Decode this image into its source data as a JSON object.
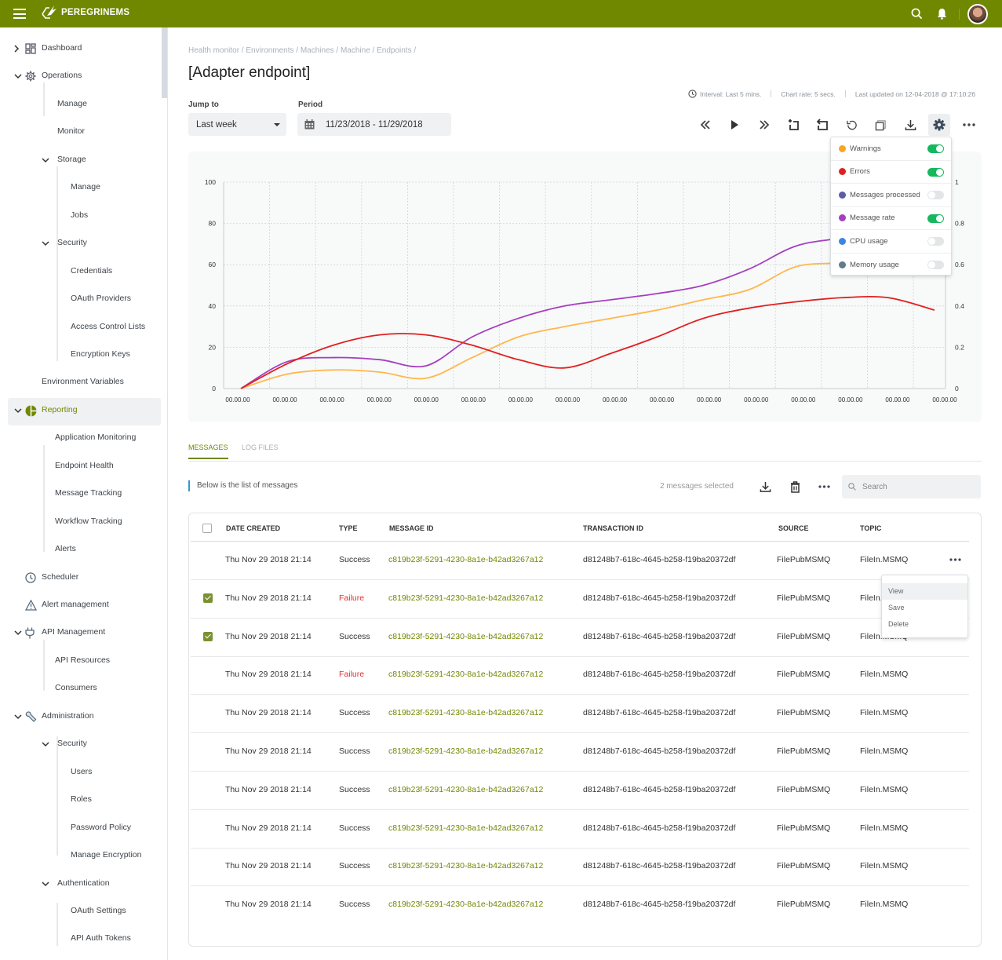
{
  "app": {
    "brand": "PEREGRINEMS",
    "brand_color": "#6f8800"
  },
  "topbar": {
    "icons": [
      "menu-icon",
      "search-icon",
      "bell-icon",
      "avatar"
    ]
  },
  "sidebar": {
    "items": [
      {
        "label": "Dashboard",
        "icon": "dashboard-icon",
        "level": 0,
        "expander": "chevron-right"
      },
      {
        "label": "Operations",
        "icon": "gear-icon",
        "level": 0,
        "expander": "chevron-down"
      },
      {
        "label": "Manage",
        "level": 1
      },
      {
        "label": "Monitor",
        "level": 1
      },
      {
        "label": "Storage",
        "level": 1,
        "expander": "chevron-down"
      },
      {
        "label": "Manage",
        "level": 2
      },
      {
        "label": "Jobs",
        "level": 2
      },
      {
        "label": "Security",
        "level": 1,
        "expander": "chevron-down"
      },
      {
        "label": "Credentials",
        "level": 2
      },
      {
        "label": "OAuth Providers",
        "level": 2
      },
      {
        "label": "Access Control Lists",
        "level": 2
      },
      {
        "label": "Encryption Keys",
        "level": 2
      },
      {
        "label": "Environment Variables",
        "level": 0
      },
      {
        "label": "Reporting",
        "icon": "pie-chart-icon",
        "level": 0,
        "expander": "chevron-down",
        "active": true
      },
      {
        "label": "Application Monitoring",
        "level": 1,
        "selected": true
      },
      {
        "label": "Endpoint Health",
        "level": 1
      },
      {
        "label": "Message Tracking",
        "level": 1
      },
      {
        "label": "Workflow Tracking",
        "level": 1
      },
      {
        "label": "Alerts",
        "level": 1
      },
      {
        "label": "Scheduler",
        "icon": "clock-icon",
        "level": 0
      },
      {
        "label": "Alert management",
        "icon": "warning-icon",
        "level": 0
      },
      {
        "label": "API Management",
        "icon": "plug-icon",
        "level": 0,
        "expander": "chevron-down"
      },
      {
        "label": "API Resources",
        "level": 1
      },
      {
        "label": "Consumers",
        "level": 1
      },
      {
        "label": "Administration",
        "icon": "wrench-icon",
        "level": 0,
        "expander": "chevron-down"
      },
      {
        "label": "Security",
        "level": 1,
        "expander": "chevron-down"
      },
      {
        "label": "Users",
        "level": 2
      },
      {
        "label": "Roles",
        "level": 2
      },
      {
        "label": "Password Policy",
        "level": 2
      },
      {
        "label": "Manage Encryption",
        "level": 2
      },
      {
        "label": "Authentication",
        "level": 1,
        "expander": "chevron-down"
      },
      {
        "label": "OAuth Settings",
        "level": 2
      },
      {
        "label": "API Auth Tokens",
        "level": 2
      }
    ]
  },
  "page": {
    "breadcrumb": "Health monitor / Environments / Machines / Machine / Endpoints /",
    "title": "[Adapter endpoint]",
    "jump_to_label": "Jump to",
    "jump_to_value": "Last week",
    "period_label": "Period",
    "period_value": "11/23/2018 -  11/29/2018",
    "interval": "Interval: Last 5 mins.",
    "chart_rate": "Chart rate: 5 secs.",
    "last_updated": "Last updated on 12-04-2018 @ 17:10:26",
    "toolbar": [
      "rewind-icon",
      "play-icon",
      "fast-forward-icon",
      "crop-icon",
      "undo-crop-icon",
      "refresh-icon",
      "copy-icon",
      "download-icon",
      "settings-icon",
      "more-icon"
    ]
  },
  "legend": [
    {
      "label": "Warnings",
      "color": "#f5a623",
      "on": true
    },
    {
      "label": "Errors",
      "color": "#e02020",
      "on": true
    },
    {
      "label": "Messages processed",
      "color": "#5b5ea6",
      "on": false
    },
    {
      "label": "Message rate",
      "color": "#a43fbf",
      "on": true
    },
    {
      "label": "CPU usage",
      "color": "#3b86e0",
      "on": false
    },
    {
      "label": "Memory usage",
      "color": "#607d8b",
      "on": false
    }
  ],
  "chart_data": {
    "type": "line",
    "title": "",
    "xlabel": "",
    "ylabel": "",
    "x": [
      "00.00.00",
      "00.00.00",
      "00.00.00",
      "00.00.00",
      "00.00.00",
      "00.00.00",
      "00.00.00",
      "00.00.00",
      "00.00.00",
      "00.00.00",
      "00.00.00",
      "00.00.00",
      "00.00.00",
      "00.00.00",
      "00.00.00",
      "00.00.00"
    ],
    "ylim": [
      0,
      100
    ],
    "yticks": [
      0,
      20,
      40,
      60,
      80,
      100
    ],
    "y2lim": [
      0,
      1
    ],
    "y2ticks": [
      "0",
      "0.2",
      "0.4",
      "0.6",
      "0.8",
      "1"
    ],
    "grid": true,
    "legend_position": "top-right",
    "series": [
      {
        "name": "Message rate",
        "color": "#a43fbf",
        "values": [
          0,
          13,
          15,
          14,
          11,
          25,
          34,
          40,
          43,
          46,
          50,
          58,
          69,
          73,
          77,
          80
        ]
      },
      {
        "name": "Warnings",
        "color": "#ffb74d",
        "values": [
          0,
          7,
          9,
          8,
          5,
          15,
          25,
          30,
          34,
          38,
          43,
          48,
          59,
          61,
          64,
          68
        ]
      },
      {
        "name": "Errors",
        "color": "#e02020",
        "values": [
          0,
          12,
          21,
          26,
          26,
          21,
          14,
          10,
          17,
          25,
          34,
          39,
          42,
          44,
          44,
          38
        ]
      }
    ]
  },
  "tabs": [
    {
      "label": "MESSAGES",
      "active": true
    },
    {
      "label": "LOG FILES",
      "active": false
    }
  ],
  "messages": {
    "description": "Below is the list of messages",
    "selected_count": "2 messages selected",
    "search_placeholder": "Search",
    "columns": [
      "DATE CREATED",
      "TYPE",
      "MESSAGE ID",
      "TRANSACTION ID",
      "SOURCE",
      "TOPIC"
    ],
    "rows": [
      {
        "checked": false,
        "date": "Thu Nov 29 2018 21:14",
        "type": "Success",
        "message_id": "c819b23f-5291-4230-8a1e-b42ad3267a12",
        "transaction_id": "d81248b7-618c-4645-b258-f19ba20372df",
        "source": "FilePubMSMQ",
        "topic": "FileIn.MSMQ"
      },
      {
        "checked": true,
        "date": "Thu Nov 29 2018 21:14",
        "type": "Failure",
        "message_id": "c819b23f-5291-4230-8a1e-b42ad3267a12",
        "transaction_id": "d81248b7-618c-4645-b258-f19ba20372df",
        "source": "FilePubMSMQ",
        "topic": "FileIn.MSMQ"
      },
      {
        "checked": true,
        "date": "Thu Nov 29 2018 21:14",
        "type": "Success",
        "message_id": "c819b23f-5291-4230-8a1e-b42ad3267a12",
        "transaction_id": "d81248b7-618c-4645-b258-f19ba20372df",
        "source": "FilePubMSMQ",
        "topic": "FileIn.MSMQ"
      },
      {
        "checked": false,
        "date": "Thu Nov 29 2018 21:14",
        "type": "Failure",
        "message_id": "c819b23f-5291-4230-8a1e-b42ad3267a12",
        "transaction_id": "d81248b7-618c-4645-b258-f19ba20372df",
        "source": "FilePubMSMQ",
        "topic": "FileIn.MSMQ"
      },
      {
        "checked": false,
        "date": "Thu Nov 29 2018 21:14",
        "type": "Success",
        "message_id": "c819b23f-5291-4230-8a1e-b42ad3267a12",
        "transaction_id": "d81248b7-618c-4645-b258-f19ba20372df",
        "source": "FilePubMSMQ",
        "topic": "FileIn.MSMQ"
      },
      {
        "checked": false,
        "date": "Thu Nov 29 2018 21:14",
        "type": "Success",
        "message_id": "c819b23f-5291-4230-8a1e-b42ad3267a12",
        "transaction_id": "d81248b7-618c-4645-b258-f19ba20372df",
        "source": "FilePubMSMQ",
        "topic": "FileIn.MSMQ"
      },
      {
        "checked": false,
        "date": "Thu Nov 29 2018 21:14",
        "type": "Success",
        "message_id": "c819b23f-5291-4230-8a1e-b42ad3267a12",
        "transaction_id": "d81248b7-618c-4645-b258-f19ba20372df",
        "source": "FilePubMSMQ",
        "topic": "FileIn.MSMQ"
      },
      {
        "checked": false,
        "date": "Thu Nov 29 2018 21:14",
        "type": "Success",
        "message_id": "c819b23f-5291-4230-8a1e-b42ad3267a12",
        "transaction_id": "d81248b7-618c-4645-b258-f19ba20372df",
        "source": "FilePubMSMQ",
        "topic": "FileIn.MSMQ"
      },
      {
        "checked": false,
        "date": "Thu Nov 29 2018 21:14",
        "type": "Success",
        "message_id": "c819b23f-5291-4230-8a1e-b42ad3267a12",
        "transaction_id": "d81248b7-618c-4645-b258-f19ba20372df",
        "source": "FilePubMSMQ",
        "topic": "FileIn.MSMQ"
      },
      {
        "checked": false,
        "date": "Thu Nov 29 2018 21:14",
        "type": "Success",
        "message_id": "c819b23f-5291-4230-8a1e-b42ad3267a12",
        "transaction_id": "d81248b7-618c-4645-b258-f19ba20372df",
        "source": "FilePubMSMQ",
        "topic": "FileIn.MSMQ"
      }
    ],
    "context_menu": [
      "View",
      "Save",
      "Delete"
    ]
  }
}
